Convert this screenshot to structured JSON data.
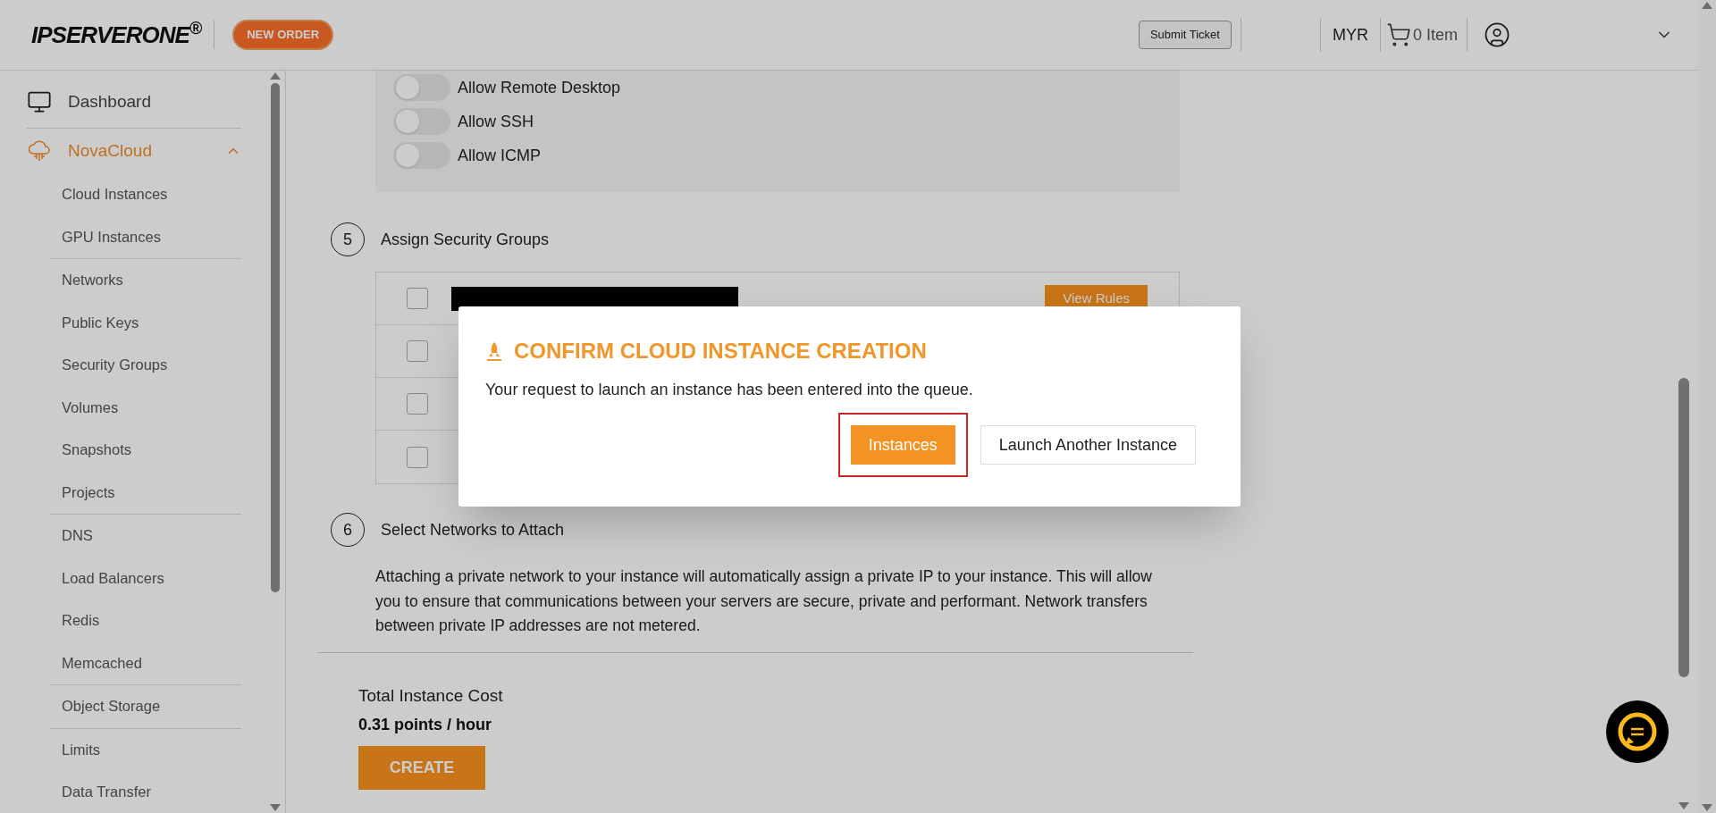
{
  "header": {
    "logo": "IPSERVERONE$^{®}$",
    "new_order": "NEW ORDER",
    "submit_ticket": "Submit Ticket",
    "currency": "MYR",
    "cart": "0 Item"
  },
  "sidebar": {
    "items": [
      {
        "kind": "link",
        "label": "Dashboard",
        "selected": false
      },
      {
        "kind": "section",
        "label": "NovaCloud",
        "selected": true,
        "expanded": true,
        "groups": [
          {
            "children": [
              {
                "label": "Cloud Instances"
              },
              {
                "label": "GPU Instances"
              }
            ]
          },
          {
            "children": [
              {
                "label": "Networks"
              },
              {
                "label": "Public Keys"
              },
              {
                "label": "Security Groups"
              },
              {
                "label": "Volumes"
              },
              {
                "label": "Snapshots"
              },
              {
                "label": "Projects"
              }
            ]
          },
          {
            "children": [
              {
                "label": "DNS"
              },
              {
                "label": "Load Balancers"
              },
              {
                "label": "Redis"
              },
              {
                "label": "Memcached"
              }
            ]
          },
          {
            "children": [
              {
                "label": "Object Storage"
              }
            ]
          },
          {
            "children": [
              {
                "label": "Limits"
              },
              {
                "label": "Data Transfer"
              }
            ]
          }
        ]
      }
    ]
  },
  "firewall": {
    "toggles": [
      {
        "label": "Allow Remote Desktop",
        "on": false
      },
      {
        "label": "Allow SSH",
        "on": false
      },
      {
        "label": "Allow ICMP",
        "on": false
      }
    ]
  },
  "steps": [
    {
      "number": "5",
      "title": "Assign Security Groups"
    },
    {
      "number": "6",
      "title": "Select Networks to Attach"
    }
  ],
  "security_groups": [
    {
      "checked": false,
      "redacted": true,
      "action": "View Rules"
    },
    {
      "checked": false,
      "redacted": false
    },
    {
      "checked": false,
      "redacted": false
    },
    {
      "checked": false,
      "redacted": false
    }
  ],
  "networks_text": "Attaching a private network to your instance will automatically assign a private IP to your instance. This will allow you to ensure that communications between your servers are secure, private and performant. Network transfers between private IP addresses are not metered.",
  "footer": {
    "label": "Total Instance Cost",
    "cost": "0.31 points / hour",
    "create": "CREATE"
  },
  "modal": {
    "title": "CONFIRM CLOUD INSTANCE CREATION",
    "message": "Your request to launch an instance has been entered into the queue.",
    "buttons": [
      {
        "label": "Instances",
        "kind": "primary",
        "focused": true
      },
      {
        "label": "Launch Another Instance",
        "kind": "secondary",
        "focused": false
      }
    ]
  }
}
